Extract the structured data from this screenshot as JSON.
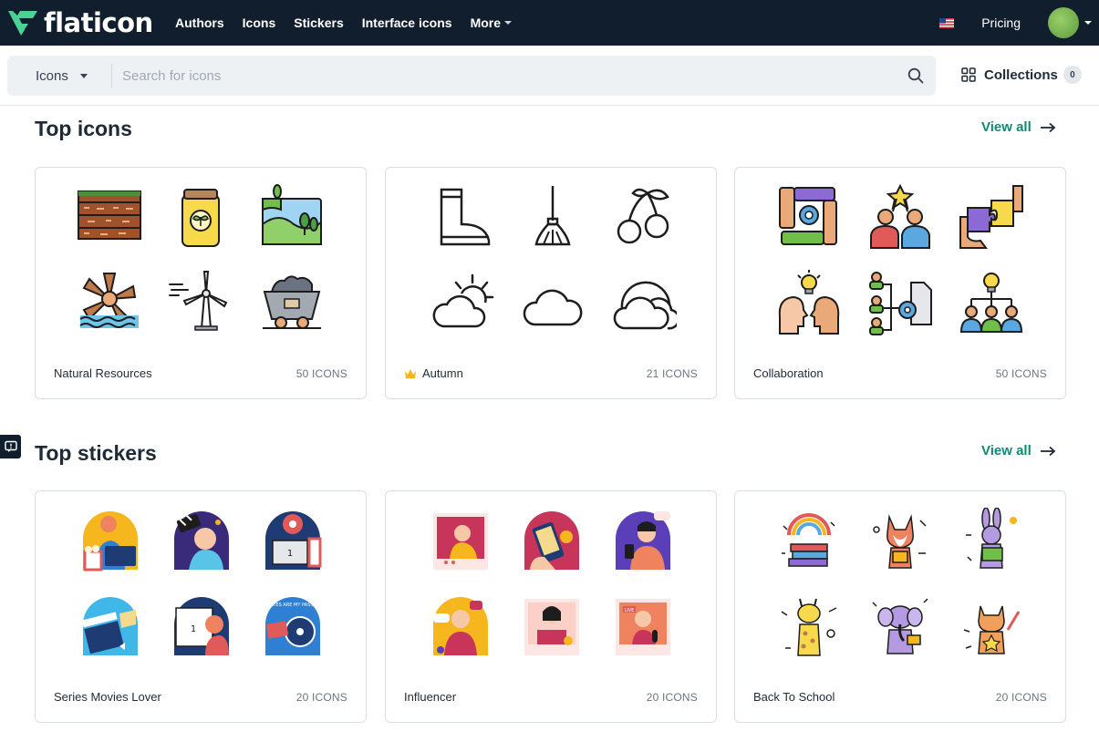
{
  "brand": {
    "name": "flaticon",
    "logo_color": "#4ad295"
  },
  "nav": {
    "links": [
      "Authors",
      "Icons",
      "Stickers",
      "Interface icons"
    ],
    "more_label": "More",
    "pricing_label": "Pricing",
    "flag_icon": "us-flag-icon"
  },
  "search": {
    "type_label": "Icons",
    "placeholder": "Search for icons",
    "value": ""
  },
  "collections": {
    "label": "Collections",
    "count": "0"
  },
  "sections": {
    "icons": {
      "title": "Top icons",
      "view_all": "View all",
      "cards": [
        {
          "name": "Natural Resources",
          "count": "50 ICONS",
          "icons": [
            "soil-layers-icon",
            "fertilizer-bag-icon",
            "landscape-trees-icon",
            "water-wheel-icon",
            "wind-turbine-icon",
            "coal-cart-icon"
          ]
        },
        {
          "name": "Autumn",
          "count": "21 ICONS",
          "premium": true,
          "icons": [
            "rain-boot-icon",
            "broom-icon",
            "cherries-icon",
            "sun-cloud-icon",
            "cloud-icon",
            "clouds-icon"
          ]
        },
        {
          "name": "Collaboration",
          "count": "50 ICONS",
          "icons": [
            "teamwork-gear-icon",
            "team-star-icon",
            "puzzle-hands-icon",
            "idea-heads-icon",
            "workflow-icon",
            "team-idea-icon"
          ]
        }
      ]
    },
    "stickers": {
      "title": "Top stickers",
      "view_all": "View all",
      "cards": [
        {
          "name": "Series Movies Lover",
          "count": "20 ICONS",
          "icons": [
            "popcorn-laptop-sticker",
            "clapper-girl-sticker",
            "cinema-laptop-sticker",
            "clapperboard-sticker",
            "screen-viewer-sticker",
            "film-reel-sticker"
          ],
          "sticker_labels": [
            "1",
            "1",
            "MOVIES ARE MY PASSION"
          ]
        },
        {
          "name": "Influencer",
          "count": "20 ICONS",
          "icons": [
            "photo-influencer-sticker",
            "phone-hand-sticker",
            "selfie-sticker",
            "chat-girl-sticker",
            "photo-cake-sticker",
            "live-stream-sticker"
          ],
          "sticker_labels": [
            "LIVE"
          ]
        },
        {
          "name": "Back To School",
          "count": "20 ICONS",
          "icons": [
            "books-rainbow-sticker",
            "fox-student-sticker",
            "rabbit-reader-sticker",
            "giraffe-student-sticker",
            "elephant-student-sticker",
            "cat-student-sticker"
          ]
        }
      ]
    }
  },
  "colors": {
    "nav_bg": "#101e2e",
    "accent": "#0f8a72",
    "card_border": "#d9dee3"
  }
}
